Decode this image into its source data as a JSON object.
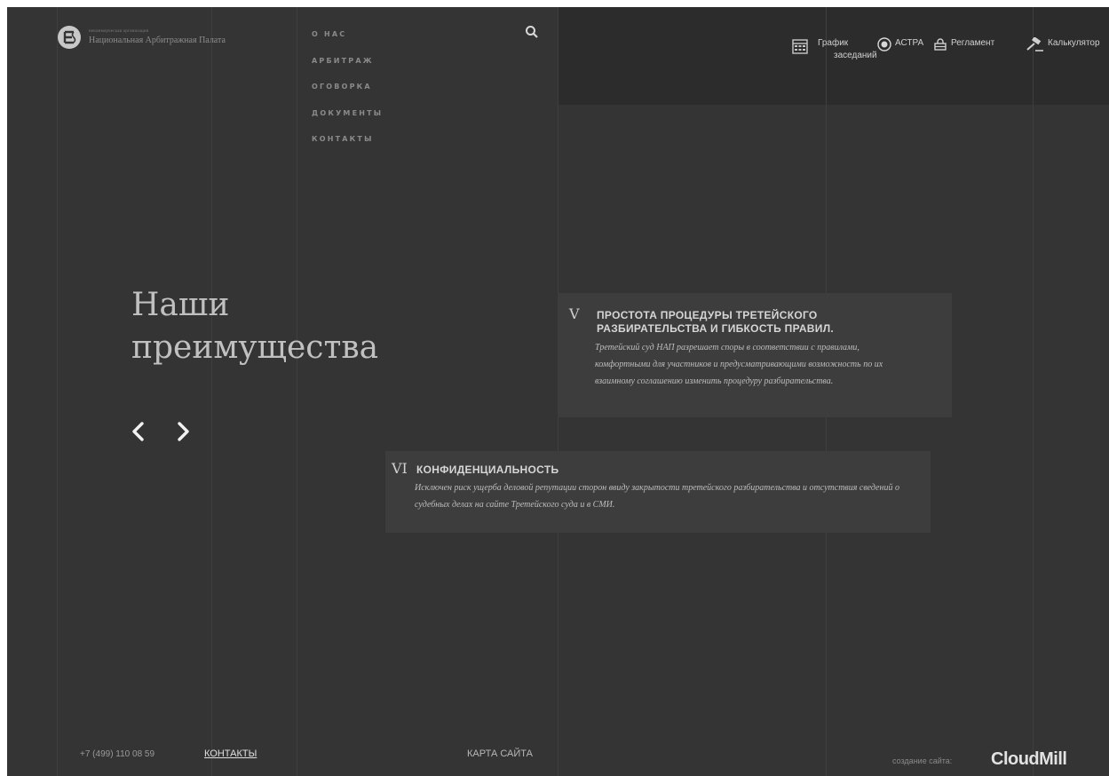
{
  "header": {
    "logo_small_text": "некоммерческая организация",
    "logo_name": "Национальная Арбитражная Палата"
  },
  "main_nav": [
    "О НАС",
    "АРБИТРАЖ",
    "ОГОВОРКА",
    "ДОКУМЕНТЫ",
    "КОНТАКТЫ"
  ],
  "top_nav": {
    "schedule_line1": "График",
    "schedule_line2": "заседаний",
    "astra": "АСТРА",
    "reglament": "Регламент",
    "calculator": "Калькулятор"
  },
  "hero": {
    "title": "Наши преимущества"
  },
  "advantages": [
    {
      "number": "V",
      "title": "ПРОСТОТА ПРОЦЕДУРЫ ТРЕТЕЙСКОГО РАЗБИРАТЕЛЬСТВА И ГИБКОСТЬ ПРАВИЛ.",
      "text": "Третейский суд НАП разрешает споры в соответствии с правилами, комфортными для участников и предусматривающими возможность по их взаимному соглашению изменить процедуру разбирательства."
    },
    {
      "number": "VI",
      "title": "КОНФИДЕНЦИАЛЬНОСТЬ",
      "text": "Исключен риск ущерба деловой репутации сторон ввиду закрытости третейского разбирательства и отсутствия сведений о судебных делах на сайте Третейского суда и в СМИ."
    }
  ],
  "footer": {
    "phone": "+7 (499) 110 08 59",
    "contacts": "КОНТАКТЫ",
    "sitemap": "КАРТА САЙТА",
    "made_by": "создание сайта:",
    "brand": "CloudMill"
  }
}
